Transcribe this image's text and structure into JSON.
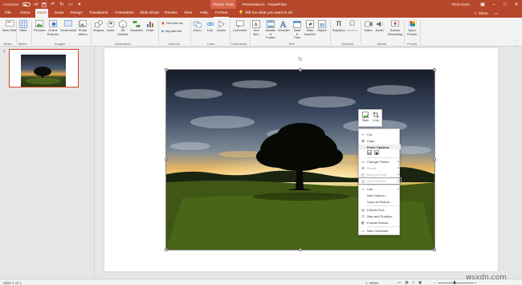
{
  "titlebar": {
    "autosave_label": "AutoSave",
    "autosave_state": "Off",
    "picture_tools": "Picture Tools",
    "title": "Presentation1 - PowerPoint",
    "user": "Tricia Goss"
  },
  "tabs": [
    "File",
    "Home",
    "Insert",
    "Draw",
    "Design",
    "Transitions",
    "Animations",
    "Slide Show",
    "Review",
    "View",
    "Help",
    "Format"
  ],
  "active_tab": "Insert",
  "tellme": "Tell me what you want to do",
  "share": "Share",
  "comments": "Comments",
  "ribbon": {
    "buttons": {
      "new_slide": "New Slide",
      "table": "Table",
      "pictures": "Pictures",
      "online_pictures": "Online Pictures",
      "screenshot": "Screenshot",
      "photo_album": "Photo Album",
      "shapes": "Shapes",
      "icons": "Icons",
      "models_3d": "3D Models",
      "smartart": "SmartArt",
      "chart": "Chart",
      "get_addins": "Get Add-ins",
      "my_addins": "My Add-ins",
      "zoom": "Zoom",
      "link": "Link",
      "action": "Action",
      "comment": "Comment",
      "text_box": "Text Box",
      "header_footer": "Header & Footer",
      "wordart": "WordArt",
      "date_time": "Date & Time",
      "slide_number": "Slide Number",
      "object": "Object",
      "equation": "Equation",
      "symbol": "Symbol",
      "video": "Video",
      "audio": "Audio",
      "screen_recording": "Screen Recording",
      "open_pexels": "Open Pexels"
    },
    "groups": {
      "slides": "Slides",
      "tables": "Tables",
      "images": "Images",
      "illustrations": "Illustrations",
      "addins": "Add-ins",
      "links": "Links",
      "comments": "Comments",
      "text": "Text",
      "symbols": "Symbols",
      "media": "Media",
      "pexels": "Pexels"
    }
  },
  "thumb_number": "1",
  "mini_toolbar": {
    "style": "Style",
    "crop": "Crop"
  },
  "context_menu": {
    "cut": "Cut",
    "copy": "Copy",
    "paste_options": "Paste Options:",
    "change_picture": "Change Picture",
    "group": "Group",
    "bring_to_front": "Bring to Front",
    "send_to_back": "Send to Back",
    "link": "Link",
    "new_search": "New Search...",
    "save_as_picture": "Save as Picture...",
    "edit_alt_text": "Edit Alt Text...",
    "size_and_position": "Size and Position...",
    "format_picture": "Format Picture...",
    "new_comment": "New Comment"
  },
  "status": {
    "slide": "Slide 1 of 1",
    "notes": "Notes"
  },
  "watermark": "wsxdn.com",
  "colors": {
    "brand": "#b7472a",
    "accent_border": "#d24726"
  }
}
